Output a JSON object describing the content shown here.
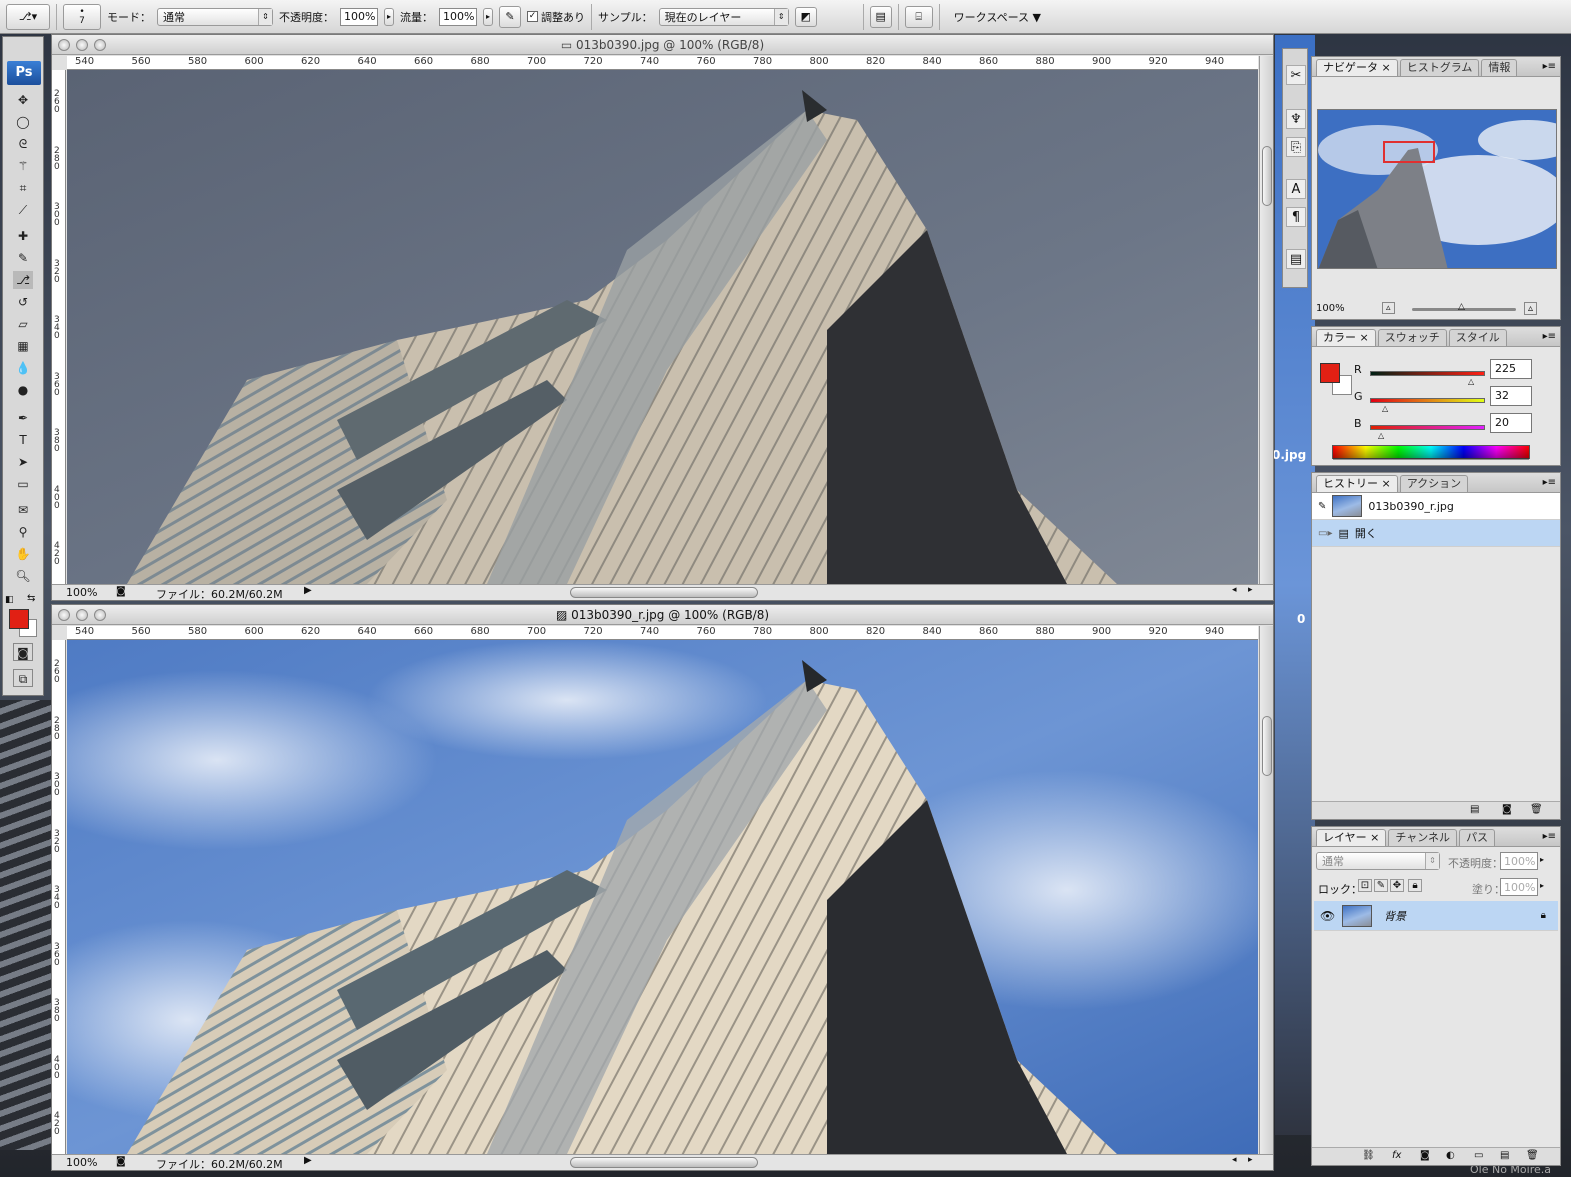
{
  "options_bar": {
    "brush_size": "7",
    "mode_label": "モード：",
    "mode_value": "通常",
    "opacity_label": "不透明度：",
    "opacity_value": "100%",
    "flow_label": "流量：",
    "flow_value": "100%",
    "aligned_label": "調整あり",
    "sample_label": "サンプル：",
    "sample_value": "現在のレイヤー",
    "workspace_label": "ワークスペース"
  },
  "toolbox": {
    "logo": "Ps"
  },
  "windows": [
    {
      "title": "013b0390.jpg @ 100% (RGB/8)",
      "zoom": "100%",
      "file_info": "ファイル：60.2M/60.2M",
      "ruler_labels": [
        "540",
        "560",
        "580",
        "600",
        "620",
        "640",
        "660",
        "680",
        "700",
        "720",
        "740",
        "760",
        "780",
        "800",
        "820",
        "840",
        "860",
        "880",
        "900",
        "920",
        "940"
      ],
      "vruler_labels": [
        "260",
        "280",
        "300",
        "320",
        "340",
        "360",
        "380",
        "400",
        "420"
      ]
    },
    {
      "title": "013b0390_r.jpg @ 100% (RGB/8)",
      "zoom": "100%",
      "file_info": "ファイル：60.2M/60.2M",
      "ruler_labels": [
        "540",
        "560",
        "580",
        "600",
        "620",
        "640",
        "660",
        "680",
        "700",
        "720",
        "740",
        "760",
        "780",
        "800",
        "820",
        "840",
        "860",
        "880",
        "900",
        "920",
        "940"
      ],
      "vruler_labels": [
        "260",
        "280",
        "300",
        "320",
        "340",
        "360",
        "380",
        "400",
        "420"
      ]
    }
  ],
  "navigator": {
    "tabs": [
      "ナビゲータ",
      "ヒストグラム",
      "情報"
    ],
    "zoom": "100%"
  },
  "color": {
    "tabs": [
      "カラー",
      "スウォッチ",
      "スタイル"
    ],
    "foreground": "#e12014",
    "channels": [
      {
        "name": "R",
        "value": "225"
      },
      {
        "name": "G",
        "value": "32"
      },
      {
        "name": "B",
        "value": "20"
      }
    ]
  },
  "history": {
    "tabs": [
      "ヒストリー",
      "アクション"
    ],
    "snapshot": "013b0390_r.jpg",
    "items": [
      "開く"
    ]
  },
  "layers": {
    "tabs": [
      "レイヤー",
      "チャンネル",
      "パス"
    ],
    "blend": "通常",
    "opacity_label": "不透明度：",
    "opacity_value": "100%",
    "lock_label": "ロック：",
    "fill_label": "塗り：",
    "fill_value": "100%",
    "layer_name": "背景"
  },
  "desktop": {
    "right_edge_text": "0.jpg",
    "right_edge_digit": "0",
    "bottom_text": "Ole No Moire.a"
  }
}
